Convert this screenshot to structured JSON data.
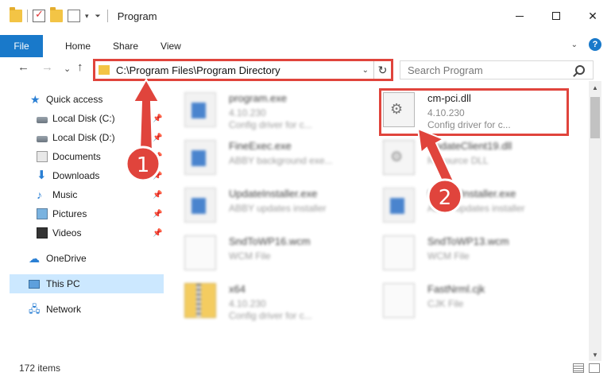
{
  "window": {
    "title": "Program",
    "minimize": "—",
    "close": "✕"
  },
  "ribbon": {
    "tabs": [
      "File",
      "Home",
      "Share",
      "View"
    ],
    "collapse_glyph": "⌃",
    "help_glyph": "?"
  },
  "nav_buttons": {
    "back": "←",
    "forward": "→",
    "recent": "⌄",
    "up": "↑"
  },
  "address": {
    "path": "C:\\Program Files\\Program Directory",
    "refresh_glyph": "↻",
    "dropdown_glyph": "⌄"
  },
  "search": {
    "placeholder": "Search Program"
  },
  "sidebar": {
    "items": [
      {
        "label": "Quick access",
        "icon": "star-icon",
        "pinned": false
      },
      {
        "label": "Local Disk (C:)",
        "icon": "drive-icon",
        "pinned": true
      },
      {
        "label": "Local Disk (D:)",
        "icon": "drive-icon",
        "pinned": true
      },
      {
        "label": "Documents",
        "icon": "documents-icon",
        "pinned": true
      },
      {
        "label": "Downloads",
        "icon": "download-icon",
        "pinned": true
      },
      {
        "label": "Music",
        "icon": "music-icon",
        "pinned": true
      },
      {
        "label": "Pictures",
        "icon": "pictures-icon",
        "pinned": true
      },
      {
        "label": "Videos",
        "icon": "videos-icon",
        "pinned": true
      },
      {
        "label": "OneDrive",
        "icon": "cloud-icon",
        "pinned": false
      },
      {
        "label": "This PC",
        "icon": "computer-icon",
        "pinned": false,
        "selected": true
      },
      {
        "label": "Network",
        "icon": "network-icon",
        "pinned": false
      }
    ]
  },
  "files": [
    {
      "name": "program.exe",
      "line2": "4.10.230",
      "line3": "Config driver for c...",
      "icon": "exe-icon",
      "blurred": true
    },
    {
      "name": "cm-pci.dll",
      "line2": "4.10.230",
      "line3": "Config driver for c...",
      "icon": "dll-icon",
      "blurred": false,
      "highlighted": true
    },
    {
      "name": "FineExec.exe",
      "line2": "ABBY background exe...",
      "line3": "",
      "icon": "exe-icon",
      "blurred": true
    },
    {
      "name": "UpdateClient19.dll",
      "line2": "Resource DLL",
      "line3": "",
      "icon": "dll-icon",
      "blurred": true
    },
    {
      "name": "UpdateInstaller.exe",
      "line2": "ABBY updates installer",
      "line3": "",
      "icon": "exe-icon",
      "blurred": true
    },
    {
      "name": "UpdateInstaller.exe",
      "line2": "ABBY updates installer",
      "line3": "",
      "icon": "exe-icon",
      "blurred": true
    },
    {
      "name": "SndToWP16.wcm",
      "line2": "WCM File",
      "line3": "",
      "icon": "file-icon",
      "blurred": true
    },
    {
      "name": "SndToWP13.wcm",
      "line2": "WCM File",
      "line3": "",
      "icon": "file-icon",
      "blurred": true
    },
    {
      "name": "x64",
      "line2": "4.10.230",
      "line3": "Config driver for c...",
      "icon": "zip-icon",
      "blurred": true
    },
    {
      "name": "FastNrml.cjk",
      "line2": "CJK File",
      "line3": "",
      "icon": "file-icon",
      "blurred": true
    }
  ],
  "annotations": {
    "step1": "1",
    "step2": "2",
    "accent": "#e0443c"
  },
  "status": {
    "item_count": "172 items"
  },
  "scroll": {
    "up": "▲",
    "down": "▼"
  },
  "colors": {
    "accent_blue": "#1979ca",
    "selection": "#cce8ff",
    "annotation_red": "#e0443c"
  }
}
